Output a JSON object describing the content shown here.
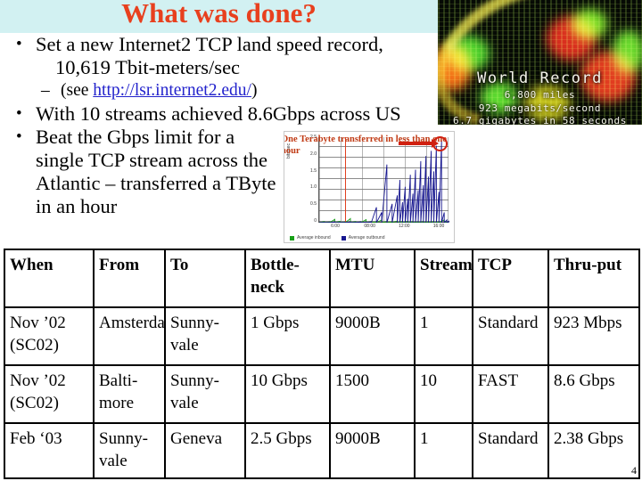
{
  "slide": {
    "title": "What was done?",
    "page_number": "4",
    "accent_color": "#e8401e",
    "header_band_color": "#d2f1f2",
    "highlight_color": "#fbfbd0"
  },
  "bullets": {
    "b1_line1": "Set a new Internet2 TCP land speed record,",
    "b1_line2": "10,619 Tbit-meters/sec",
    "sub_prefix": "(see ",
    "sub_link": "http://lsr.internet2.edu/",
    "sub_suffix": ")",
    "b2": "With 10 streams achieved 8.6Gbps across US",
    "b3": "Beat the Gbps limit for a single TCP stream across the Atlantic – transferred a TByte in an hour"
  },
  "world_record_image": {
    "title": "World Record",
    "line1": "6,800 miles",
    "line2": "923 megabits/second",
    "line3": "6.7 gigabytes in 58 seconds"
  },
  "chart_data": {
    "type": "line",
    "title": "",
    "annotation": "One Terabyte transferred in less than one hour",
    "xlabel": "",
    "ylabel": "bits/sec",
    "ylim": [
      0,
      2.5
    ],
    "yticks": [
      "2.5",
      "2.0",
      "1.5",
      "1.0",
      "0.5",
      "0"
    ],
    "xticks": [
      "6:00",
      "08:00",
      "12:00",
      "16:00"
    ],
    "grid": true,
    "legend_position": "bottom-left",
    "series": [
      {
        "name": "Average inbound",
        "color": "#18a018",
        "x": [
          0,
          4,
          8,
          12,
          16,
          20,
          24,
          28,
          32,
          36,
          40,
          44,
          48,
          52,
          56,
          60,
          64,
          68,
          72,
          76,
          80,
          84,
          88,
          92,
          96,
          100
        ],
        "values": [
          0.02,
          0.03,
          0.02,
          0.1,
          0.04,
          0.02,
          0.12,
          0.03,
          0.02,
          0.09,
          0.03,
          0.02,
          0.08,
          0.03,
          0.02,
          0.05,
          0.03,
          0.04,
          0.03,
          0.02,
          0.03,
          0.02,
          0.03,
          0.02,
          0.08,
          0.03
        ]
      },
      {
        "name": "Average outbound",
        "color": "#181890",
        "x": [
          0,
          4,
          8,
          12,
          16,
          20,
          24,
          28,
          32,
          36,
          40,
          44,
          48,
          52,
          56,
          60,
          62,
          64,
          66,
          68,
          70,
          72,
          74,
          76,
          78,
          80,
          82,
          84,
          86,
          88,
          90,
          92,
          94,
          96,
          98,
          100
        ],
        "values": [
          0.01,
          0.01,
          0.01,
          0.02,
          0.01,
          0.01,
          0.02,
          0.01,
          0.02,
          0.01,
          0.02,
          0.45,
          0.3,
          1.7,
          0.55,
          0.8,
          1.25,
          0.6,
          1.05,
          0.7,
          1.4,
          0.85,
          1.55,
          0.95,
          1.8,
          1.1,
          1.95,
          1.35,
          2.1,
          1.5,
          2.25,
          0.9,
          2.4,
          0.3,
          0.08,
          0.05
        ]
      }
    ]
  },
  "table": {
    "headers": [
      "When",
      "From",
      "To",
      "Bottle-neck",
      "MTU",
      "Streams",
      "TCP",
      "Thru-put"
    ],
    "rows": [
      {
        "when": "Nov ’02 (SC02)",
        "from": "Amsterdam",
        "to": "Sunny-vale",
        "bottleneck": "1 Gbps",
        "mtu": "9000B",
        "streams": "1",
        "tcp": "Standard",
        "thruput": "923 Mbps"
      },
      {
        "when": "Nov ’02 (SC02)",
        "from": "Balti-more",
        "to": "Sunny-vale",
        "bottleneck": "10 Gbps",
        "mtu": "1500",
        "streams": "10",
        "tcp": "FAST",
        "thruput": "8.6 Gbps"
      },
      {
        "when": "Feb ‘03",
        "from": "Sunny-vale",
        "to": "Geneva",
        "bottleneck": "2.5 Gbps",
        "mtu": "9000B",
        "streams": "1",
        "tcp": "Standard",
        "thruput": "2.38 Gbps"
      }
    ]
  }
}
